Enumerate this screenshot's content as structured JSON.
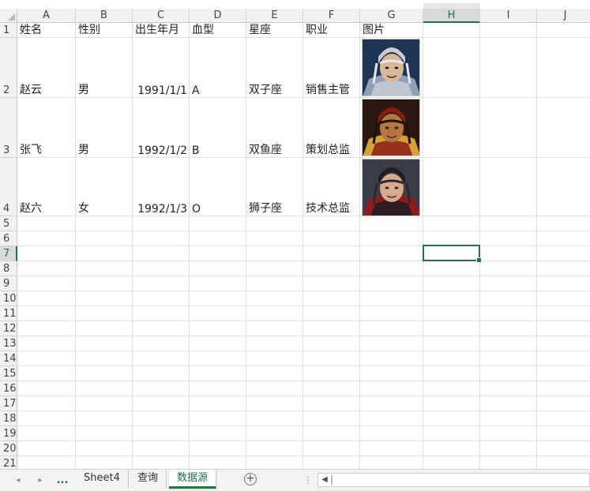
{
  "columns": [
    "A",
    "B",
    "C",
    "D",
    "E",
    "F",
    "G",
    "H",
    "I",
    "J"
  ],
  "selected_column": "H",
  "rows": [
    "1",
    "2",
    "3",
    "4",
    "5",
    "6",
    "7",
    "8",
    "9",
    "10",
    "11",
    "12",
    "13",
    "14",
    "15",
    "16",
    "17",
    "18",
    "19",
    "20",
    "21"
  ],
  "selected_row": "7",
  "header": [
    "姓名",
    "性别",
    "出生年月",
    "血型",
    "星座",
    "职业",
    "图片"
  ],
  "data": [
    {
      "name": "赵云",
      "gender": "男",
      "birth": "1991/1/1",
      "blood": "A",
      "zodiac": "双子座",
      "job": "销售主管",
      "picture": "warrior-portrait-silver-helmet"
    },
    {
      "name": "张飞",
      "gender": "男",
      "birth": "1992/1/2",
      "blood": "B",
      "zodiac": "双鱼座",
      "job": "策划总监",
      "picture": "warrior-portrait-red-headband"
    },
    {
      "name": "赵六",
      "gender": "女",
      "birth": "1992/1/3",
      "blood": "O",
      "zodiac": "狮子座",
      "job": "技术总监",
      "picture": "warrior-portrait-dark-armor"
    }
  ],
  "sheet_tabs": [
    "Sheet4",
    "查询",
    "数据源"
  ],
  "active_tab": "数据源",
  "nav": {
    "prev": "◂",
    "next": "▸",
    "more": "..."
  },
  "add_sheet": "+",
  "colors": {
    "accent": "#217346",
    "header_bg": "#f2f2f2",
    "gridline": "#e0e0e0"
  }
}
